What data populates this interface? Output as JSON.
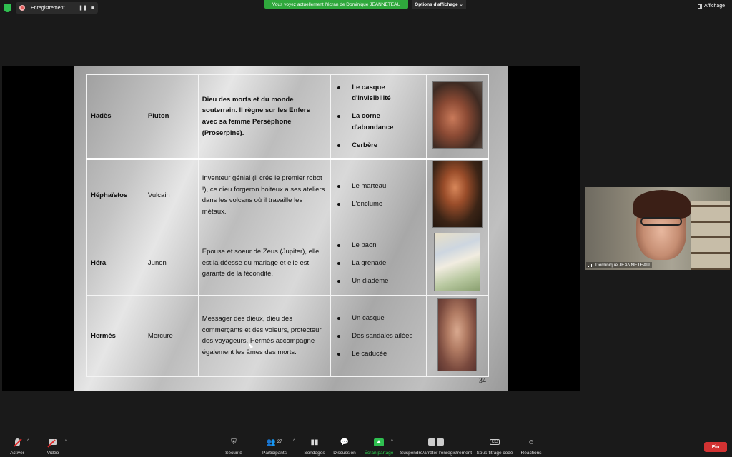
{
  "topbar": {
    "recording_label": "Enregistrement...",
    "pause_glyph": "❚❚",
    "stop_glyph": "■",
    "share_banner": "Vous voyez actuellement l'écran de Dominique JEANNETEAU",
    "view_options": "Options d'affichage",
    "view_options_caret": "⌄",
    "affichage": "Affichage",
    "colors": {
      "banner": "#2fa83c",
      "security": "#2fbf50"
    }
  },
  "slide": {
    "page_number": "34",
    "rows": [
      {
        "greek": "Hadès",
        "roman": "Pluton",
        "description": "Dieu des morts et du monde souterrain. Il règne sur les Enfers avec sa femme Perséphone (Proserpine).",
        "attributes": [
          "Le casque d'invisibilité",
          "La corne d'abondance",
          "Cerbère"
        ],
        "image_icon": "hades-painting"
      },
      {
        "greek": "Héphaïstos",
        "roman": "Vulcain",
        "description": "Inventeur génial (il crée le premier robot !), ce dieu forgeron boiteux a ses ateliers dans les volcans où il travaille les métaux.",
        "attributes": [
          "Le marteau",
          "L'enclume"
        ],
        "image_icon": "hephaistos-painting"
      },
      {
        "greek": "Héra",
        "roman": "Junon",
        "description": "Epouse et soeur de Zeus (Jupiter), elle est la déesse du mariage et elle est garante de la fécondité.",
        "attributes": [
          "Le paon",
          "La grenade",
          "Un diadème"
        ],
        "image_icon": "hera-painting"
      },
      {
        "greek": "Hermès",
        "roman": "Mercure",
        "description": "Messager des dieux, dieu des commerçants et des voleurs, protecteur des voyageurs, Hermès accompagne également les âmes des morts.",
        "attributes": [
          "Un casque",
          "Des sandales ailées",
          "Le caducée"
        ],
        "image_icon": "hermes-painting"
      }
    ]
  },
  "participant_video": {
    "name": "Dominique JEANNETEAU"
  },
  "toolbar": {
    "mute": "Activer",
    "video": "Vidéo",
    "security": "Sécurité",
    "participants": "Participants",
    "participants_count": "27",
    "polls": "Sondages",
    "chat": "Discussion",
    "share": "Écran partagé",
    "recording": "Suspendre/arrêter l'enregistrement",
    "captions": "Sous-titrage codé",
    "captions_glyph": "CC",
    "reactions": "Réactions",
    "end": "Fin",
    "caret": "^",
    "colors": {
      "end": "#d23232",
      "share_active": "#2fd150"
    }
  }
}
